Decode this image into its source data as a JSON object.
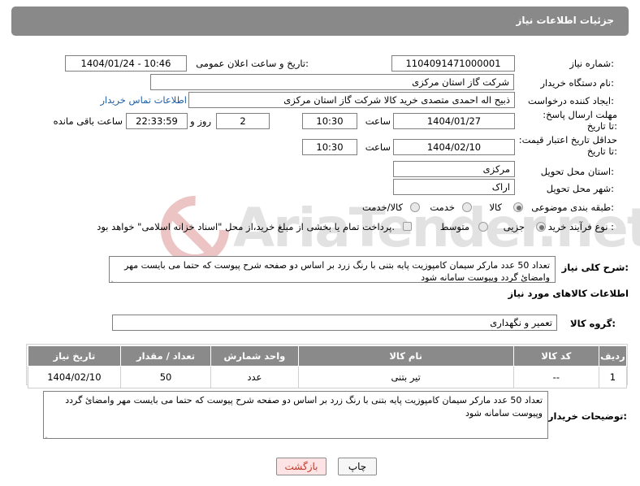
{
  "header": {
    "title": "جزئیات اطلاعات نیاز"
  },
  "fields": {
    "need_number_label": "شماره نیاز:",
    "need_number": "1104091471000001",
    "announce_label": "تاریخ و ساعت اعلان عمومی:",
    "announce_value": "1404/01/24 - 10:46",
    "buyer_org_label": "نام دستگاه خریدار:",
    "buyer_org": "شرکت گاز استان مرکزی",
    "requester_label": "ایجاد کننده درخواست:",
    "requester": "ذبیح اله احمدی متصدی خرید کالا شرکت گاز استان مرکزی",
    "contact_link": "اطلاعات تماس خریدار",
    "deadline_label": "مهلت ارسال پاسخ: تا تاریخ:",
    "deadline_date": "1404/01/27",
    "time_label": "ساعت",
    "deadline_time": "10:30",
    "days_value": "2",
    "days_label": "روز و",
    "remaining_value": "22:33:59",
    "remaining_label": "ساعت باقی مانده",
    "validity_label": "حداقل تاریخ اعتبار قیمت: تا تاریخ:",
    "validity_date": "1404/02/10",
    "validity_time": "10:30",
    "province_label": "استان محل تحویل:",
    "province": "مرکزی",
    "city_label": "شهر محل تحویل:",
    "city": "اراک",
    "category_label": "طبقه بندی موضوعی:",
    "category_options": [
      "کالا",
      "خدمت",
      "کالا/خدمت"
    ],
    "category_selected": "کالا",
    "process_label": "نوع فرآیند خرید :",
    "process_options": [
      "جزیی",
      "متوسط"
    ],
    "process_selected": "جزیی",
    "payment_note": "پرداخت تمام یا بخشی از مبلغ خرید،از محل \"اسناد خزانه اسلامی\" خواهد بود."
  },
  "description": {
    "label": "شرح کلی نیاز:",
    "text": "تعداد 50 عدد مارکر سیمان کامپوزیت پایه بتنی با رنگ زرد بر اساس  دو صفحه شرح پیوست که حتما می بایست مهر وامضائ گردد وپیوست سامانه شود"
  },
  "goods_section": {
    "title": "اطلاعات کالاهای مورد نیاز"
  },
  "goods_group": {
    "label": "گروه کالا:",
    "value": "تعمیر و نگهداری"
  },
  "table": {
    "headers": [
      "ردیف",
      "کد کالا",
      "نام کالا",
      "واحد شمارش",
      "تعداد / مقدار",
      "تاریخ نیاز"
    ],
    "rows": [
      [
        "1",
        "--",
        "تیر بتنی",
        "عدد",
        "50",
        "1404/02/10"
      ]
    ]
  },
  "buyer_notes": {
    "label": "توضیحات خریدار:",
    "text": "تعداد 50 عدد مارکر سیمان کامپوزیت پایه بتنی با رنگ زرد بر اساس  دو صفحه شرح پیوست که حتما می بایست مهر وامضائ گردد وپیوست سامانه شود"
  },
  "buttons": {
    "print": "چاپ",
    "back": "بازگشت"
  },
  "watermark": {
    "text": "AriaTender.net"
  },
  "colors": {
    "header_bg": "#898989",
    "link": "#1a5ea8",
    "back_button_bg": "#fde3e3",
    "back_button_text": "#c0392b"
  }
}
